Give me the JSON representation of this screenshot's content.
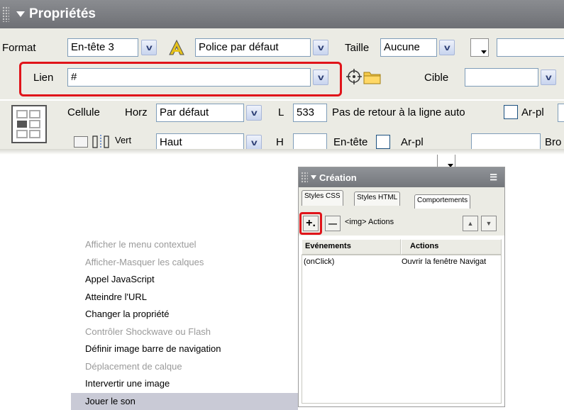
{
  "properties_panel": {
    "title": "Propriétés",
    "format_label": "Format",
    "format_value": "En-tête 3",
    "font_value": "Police par défaut",
    "size_label": "Taille",
    "size_value": "Aucune",
    "link_label": "Lien",
    "link_value": "#",
    "target_label": "Cible",
    "target_value": "",
    "cell_label": "Cellule",
    "horz_label": "Horz",
    "horz_value": "Par défaut",
    "vert_label": "Vert",
    "vert_value": "Haut",
    "width_label": "L",
    "width_value": "533",
    "height_label": "H",
    "height_value": "",
    "nowrap_label": "Pas de retour à la ligne auto",
    "bg_label": "Ar-pl",
    "header_label": "En-tête",
    "bg2_label": "Ar-pl",
    "border_label": "Bro"
  },
  "creation_panel": {
    "title": "Création",
    "tabs": [
      "Styles CSS",
      "Styles HTML",
      "Comportements"
    ],
    "add_label": "+.",
    "remove_label": "—",
    "tag_label": "<img> Actions",
    "col_events": "Evénements",
    "col_actions": "Actions",
    "rows": [
      {
        "event": "(onClick)",
        "action": "Ouvrir la fenêtre Navigat"
      }
    ]
  },
  "context_menu": {
    "items": [
      {
        "label": "Afficher le menu contextuel",
        "disabled": true
      },
      {
        "label": "Afficher-Masquer les calques",
        "disabled": true
      },
      {
        "label": "Appel JavaScript",
        "disabled": false
      },
      {
        "label": "Atteindre l'URL",
        "disabled": false
      },
      {
        "label": "Changer la propriété",
        "disabled": false
      },
      {
        "label": "Contrôler Shockwave ou Flash",
        "disabled": true
      },
      {
        "label": "Définir image barre de navigation",
        "disabled": false
      },
      {
        "label": "Déplacement de calque",
        "disabled": true
      },
      {
        "label": "Intervertir une image",
        "disabled": false
      },
      {
        "label": "Jouer le son",
        "disabled": false,
        "selected": true
      }
    ]
  },
  "colors": {
    "highlight_red": "#e0141a",
    "panel_bg": "#ebebe4",
    "header_gray": "#74777c"
  }
}
